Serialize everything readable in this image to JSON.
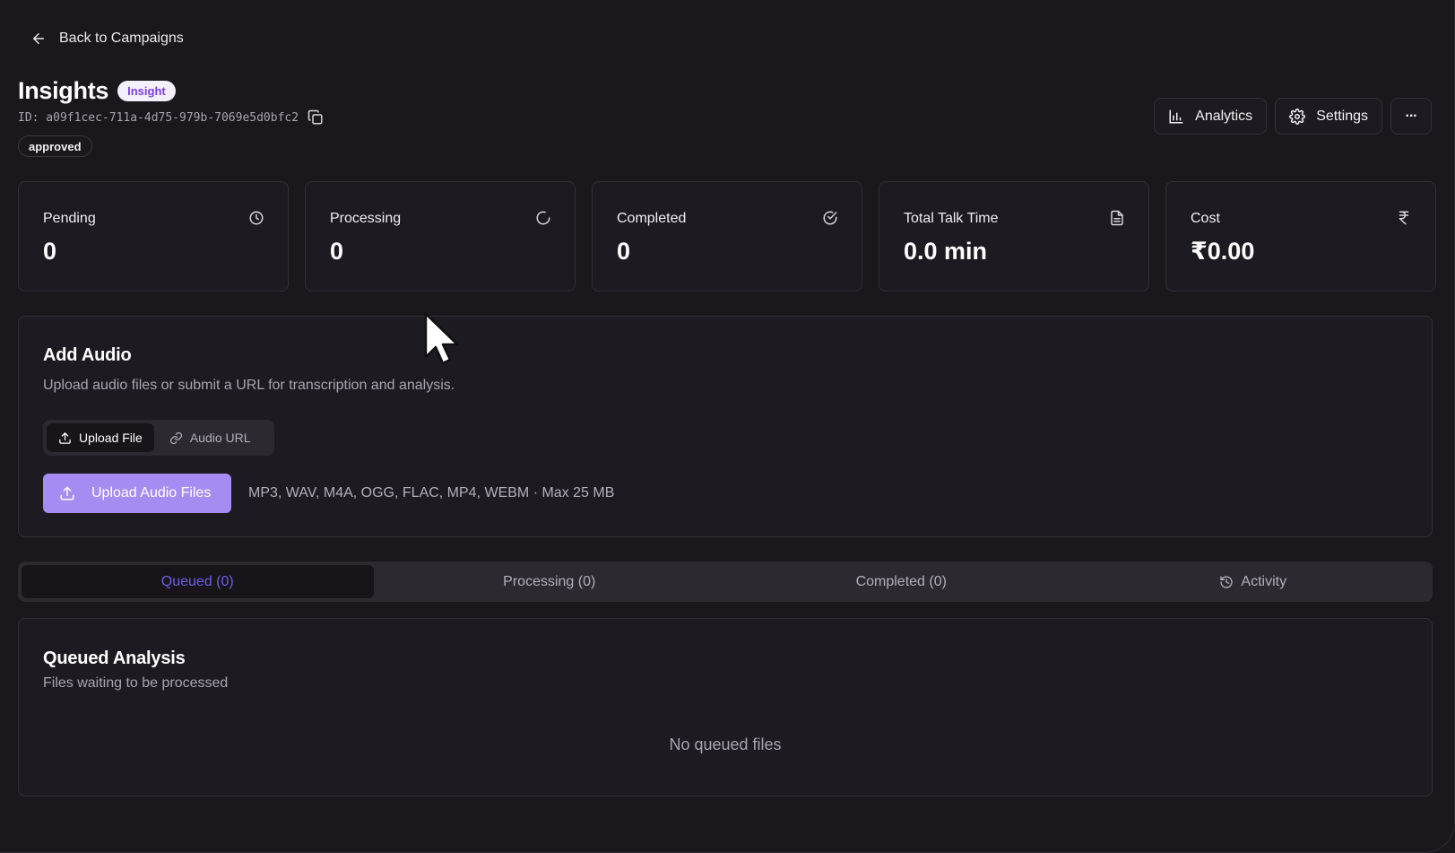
{
  "nav": {
    "back_label": "Back to Campaigns"
  },
  "header": {
    "title": "Insights",
    "type_badge": "Insight",
    "id_text": "ID: a09f1cec-711a-4d75-979b-7069e5d0bfc2",
    "status_badge": "approved",
    "actions": {
      "analytics_label": "Analytics",
      "settings_label": "Settings",
      "more_label": "···"
    }
  },
  "stats": [
    {
      "label": "Pending",
      "value": "0",
      "icon": "clock-icon"
    },
    {
      "label": "Processing",
      "value": "0",
      "icon": "refresh-icon"
    },
    {
      "label": "Completed",
      "value": "0",
      "icon": "check-circle-icon"
    },
    {
      "label": "Total Talk Time",
      "value": "0.0 min",
      "icon": "document-icon"
    },
    {
      "label": "Cost",
      "value": "₹0.00",
      "icon": "rupee-icon"
    }
  ],
  "add_audio": {
    "title": "Add Audio",
    "description": "Upload audio files or submit a URL for transcription and analysis.",
    "modes": [
      {
        "label": "Upload File",
        "active": true
      },
      {
        "label": "Audio URL",
        "active": false
      }
    ],
    "upload_button": "Upload Audio Files",
    "formats": "MP3, WAV, M4A, OGG, FLAC, MP4, WEBM · Max 25 MB"
  },
  "tabs": [
    {
      "label": "Queued (0)",
      "active": true
    },
    {
      "label": "Processing (0)",
      "active": false
    },
    {
      "label": "Completed (0)",
      "active": false
    },
    {
      "label": "Activity",
      "active": false
    }
  ],
  "queued": {
    "title": "Queued Analysis",
    "description": "Files waiting to be processed",
    "empty_text": "No queued files"
  },
  "colors": {
    "background": "#1a171d",
    "card": "#1d1a21",
    "accent": "#a48cf2",
    "active_tab_text": "#6d5de8",
    "badge_text": "#7b3fe4"
  }
}
